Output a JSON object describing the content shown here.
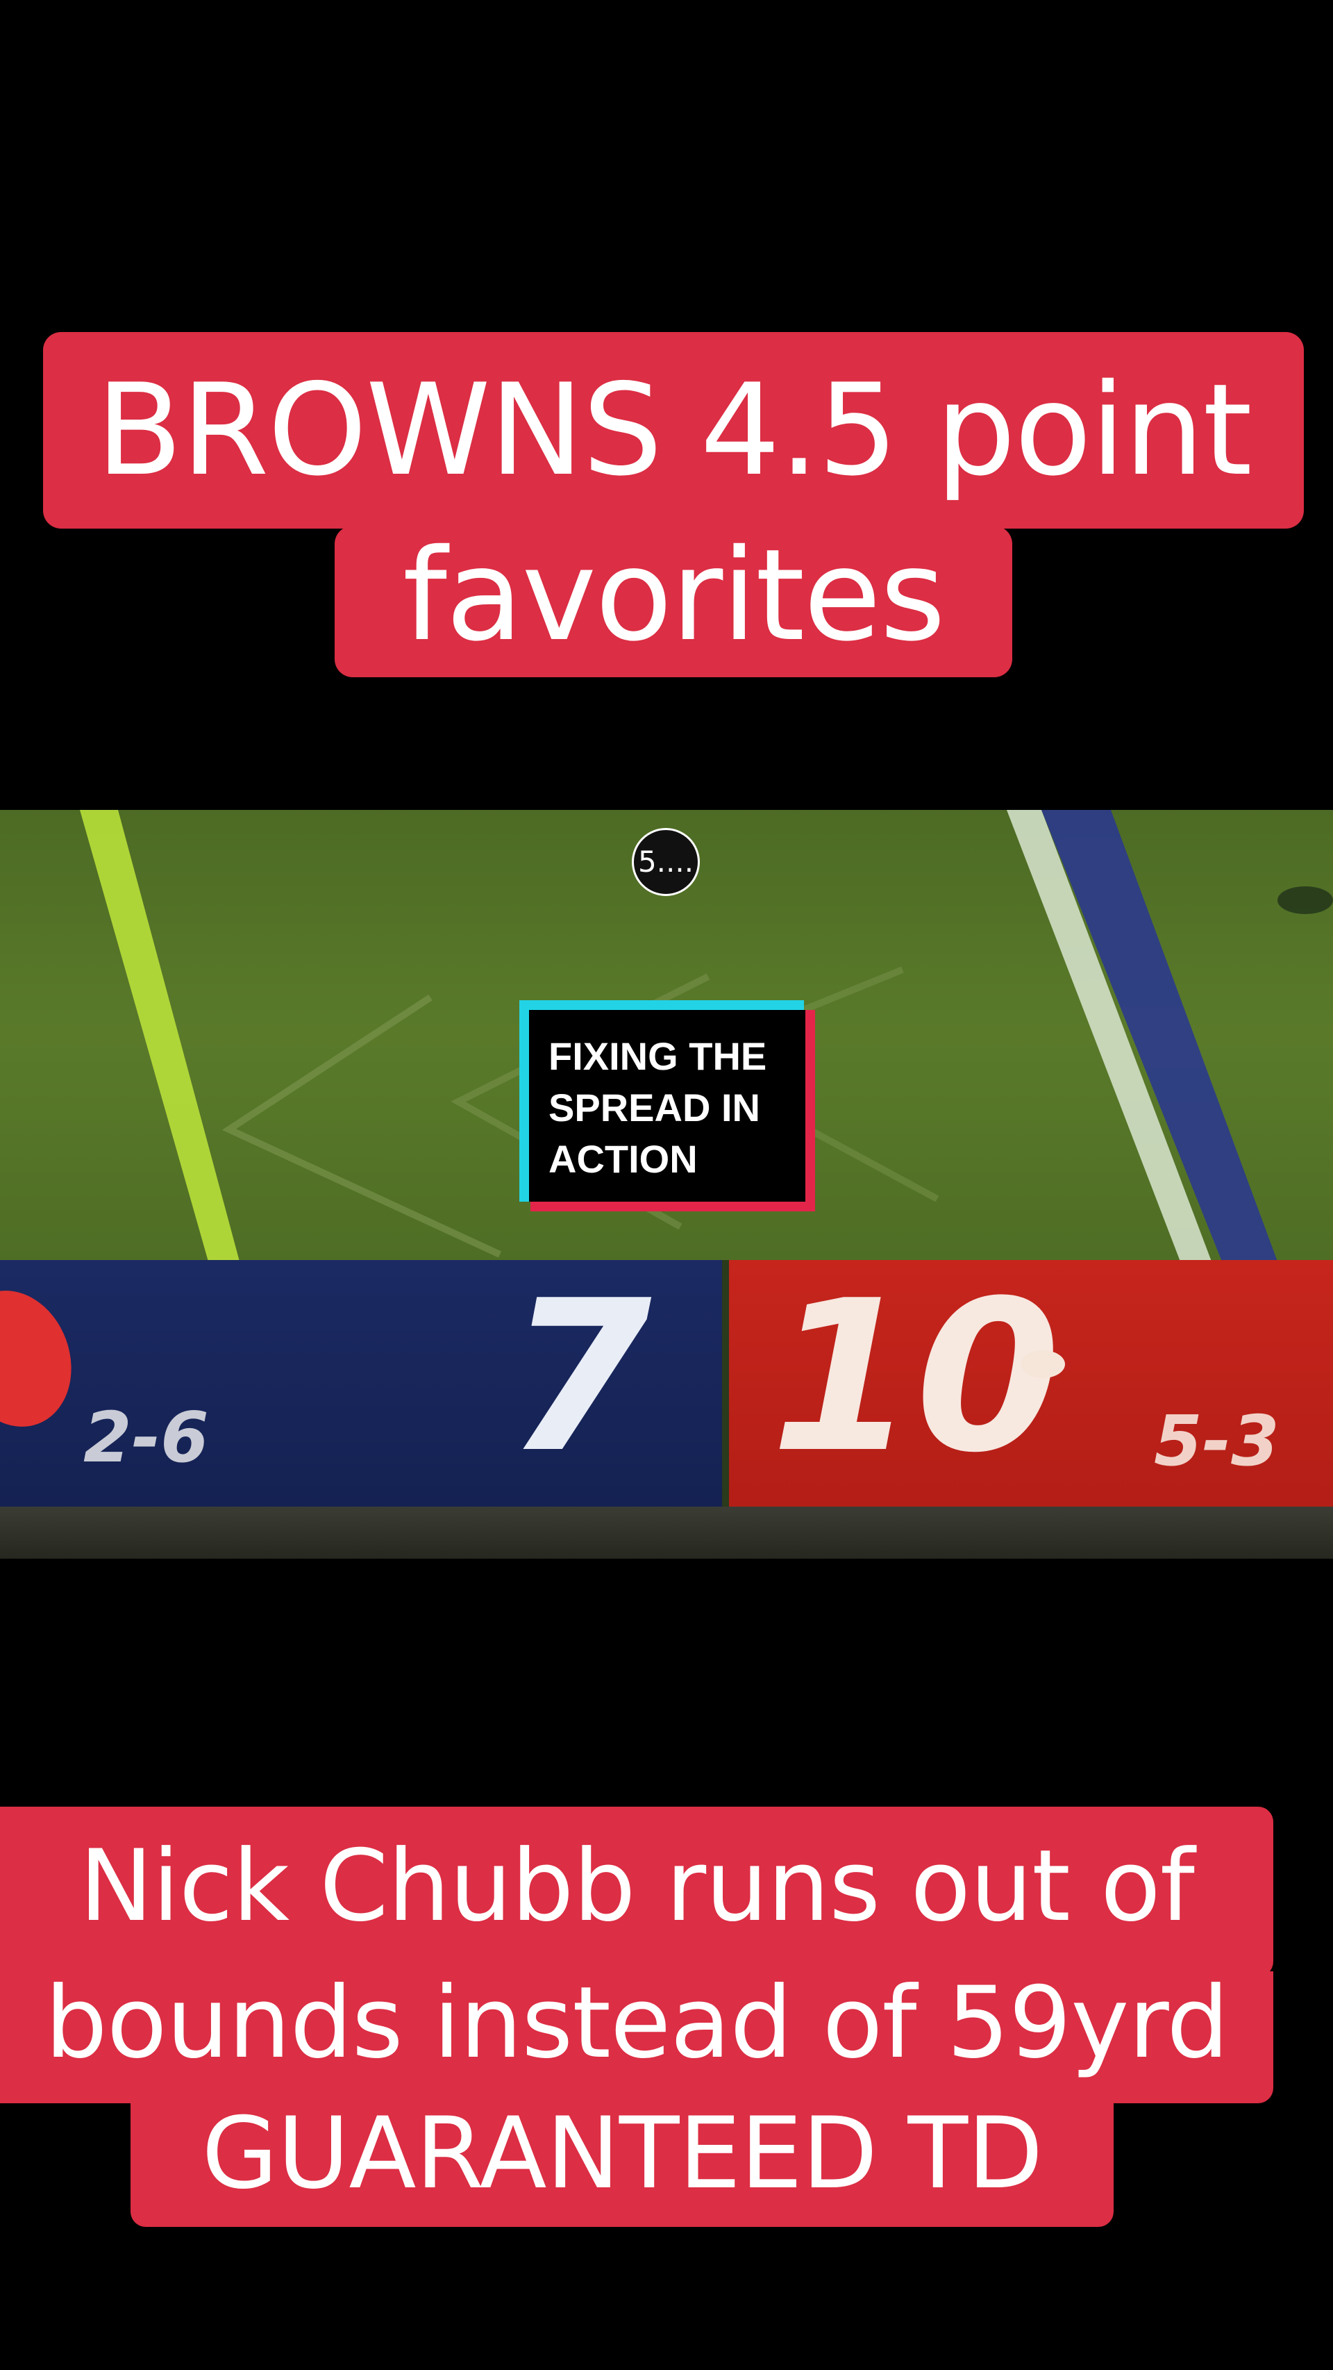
{
  "caption_top": {
    "line1": "BROWNS 4.5 point",
    "line2": "favorites"
  },
  "video": {
    "countdown": "5....",
    "title_card": {
      "line1": "FIXING THE",
      "line2": "SPREAD IN",
      "line3": "ACTION"
    },
    "scoreboard": {
      "away_record": "2-6",
      "away_score": "7",
      "home_score": "10",
      "home_record": "5-3",
      "away_color": "#1b2a63",
      "home_color": "#c6251c"
    }
  },
  "caption_bottom": {
    "line1": "Nick Chubb runs out of",
    "line2": "bounds instead of 59yrd",
    "line3": "GUARANTEED TD"
  },
  "colors": {
    "caption_bg": "#dc2e44",
    "card_cyan": "#22d3e6",
    "card_red": "#e4254a"
  }
}
